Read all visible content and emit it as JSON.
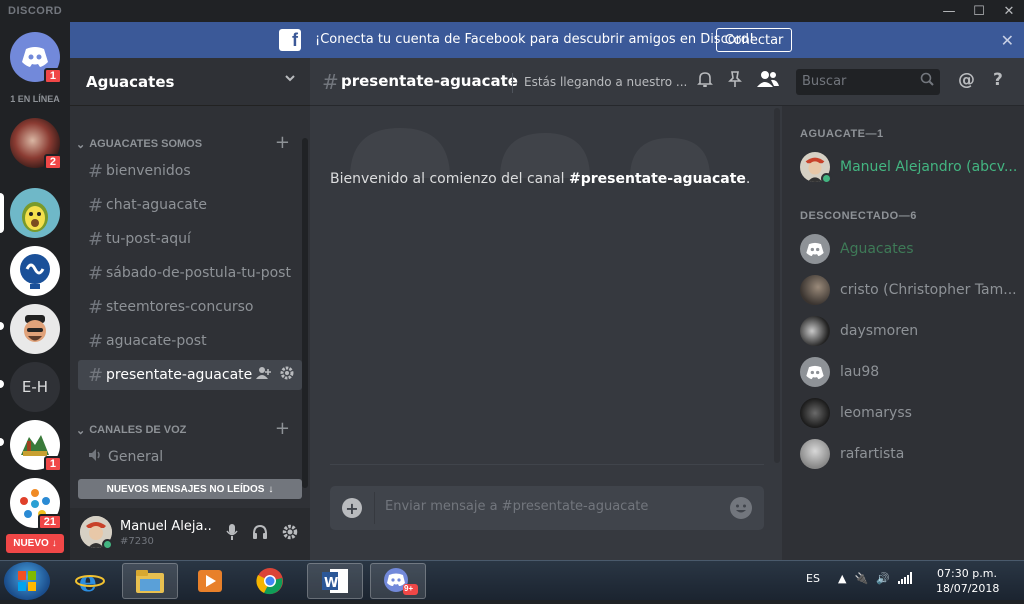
{
  "window": {
    "app_name": "DISCORD",
    "controls": [
      "—",
      "☐",
      "✕"
    ]
  },
  "servers": {
    "online_label": "1 EN LÍNEA",
    "home_badge": "1",
    "items": [
      {
        "name": "avatar-red",
        "badge": "2"
      },
      {
        "name": "aguacate",
        "badge": ""
      },
      {
        "name": "steem",
        "badge": ""
      },
      {
        "name": "cartoon",
        "badge": ""
      },
      {
        "name": "E-H",
        "label": "E-H",
        "badge": ""
      },
      {
        "name": "maracay",
        "badge": "1"
      },
      {
        "name": "colorful",
        "badge": "21"
      }
    ],
    "new_label": "NUEVO"
  },
  "banner": {
    "text": "¡Conecta tu cuenta de Facebook para descubrir amigos en Discord!",
    "button": "Conectar",
    "close": "✕"
  },
  "guild": {
    "name": "Aguacates",
    "categories": [
      {
        "label": "AGUACATES SOMOS"
      },
      {
        "label": "CANALES DE VOZ"
      }
    ],
    "text_channels": [
      "bienvenidos",
      "chat-aguacate",
      "tu-post-aquí",
      "sábado-de-postula-tu-post",
      "steemtores-concurso",
      "aguacate-post",
      "presentate-aguacate"
    ],
    "voice_channels": [
      "General"
    ],
    "new_messages": "NUEVOS MENSAJES NO LEÍDOS"
  },
  "user": {
    "name": "Manuel Aleja..",
    "tag": "#7230"
  },
  "chat": {
    "channel": "presentate-aguacate",
    "topic": "Estás llegando a nuestro ...",
    "search_placeholder": "Buscar",
    "welcome_prefix": "Bienvenido al comienzo del canal ",
    "welcome_channel": "#presentate-aguacate",
    "welcome_suffix": ".",
    "composer_placeholder": "Enviar mensaje a #presentate-aguacate"
  },
  "members": {
    "groups": [
      {
        "label": "AGUACATE—1",
        "members": [
          {
            "name": "Manuel Alejandro (abcv...",
            "color": "#43b581",
            "online": true
          }
        ]
      },
      {
        "label": "DESCONECTADO—6",
        "members": [
          {
            "name": "Aguacates",
            "color": "#3e7a57"
          },
          {
            "name": "cristo (Christopher Tam...",
            "color": "#8e9297"
          },
          {
            "name": "daysmoren",
            "color": "#8e9297"
          },
          {
            "name": "lau98",
            "color": "#8e9297"
          },
          {
            "name": "leomaryss",
            "color": "#8e9297"
          },
          {
            "name": "rafartista",
            "color": "#8e9297"
          }
        ]
      }
    ]
  },
  "taskbar": {
    "lang": "ES",
    "time": "07:30 p.m.",
    "date": "18/07/2018",
    "discord_badge": "9+"
  },
  "colors": {
    "accent": "#7289da",
    "online": "#43b581",
    "badge": "#f04747",
    "facebook": "#3b5998"
  }
}
